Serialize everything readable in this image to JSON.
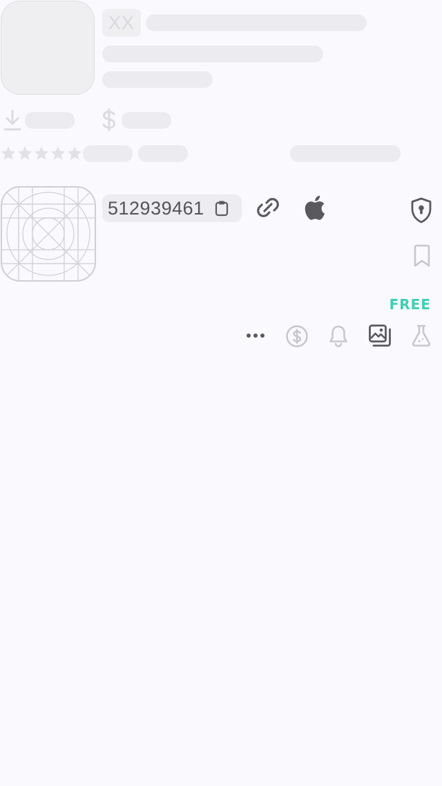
{
  "skeleton": {
    "badge_text": "XX"
  },
  "app": {
    "id": "512939461",
    "price": "FREE"
  },
  "colors": {
    "background": "#faf9fe",
    "skeleton": "#ececf0",
    "price_accent": "#3bcfb6",
    "icon_dark": "#5a5a5e",
    "icon_light": "#c8c8cc"
  },
  "icons": {
    "copy": "clipboard-icon",
    "link": "link-icon",
    "platform": "apple-icon",
    "privacy": "shield-lock-icon",
    "bookmark": "bookmark-icon",
    "more": "ellipsis-icon",
    "price_alert": "dollar-circle-icon",
    "notify": "bell-icon",
    "screenshots": "images-icon",
    "beta": "flask-icon"
  }
}
